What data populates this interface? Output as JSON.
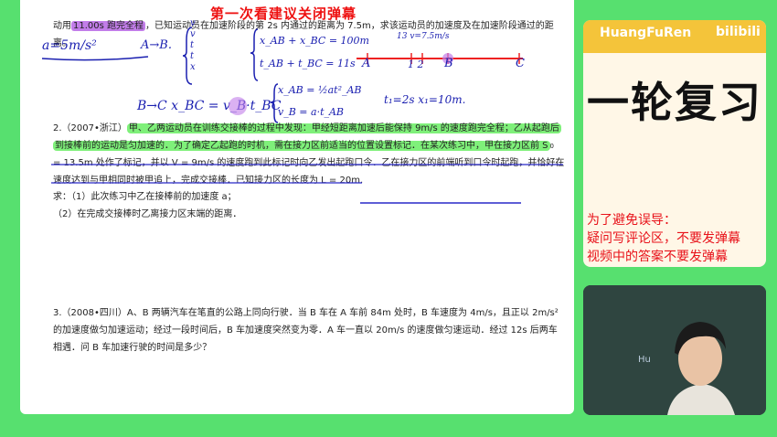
{
  "danmaku_warning": "第一次看建议关闭弹幕",
  "doc": {
    "top_line": "离。",
    "top_line_prefix": "动用",
    "top_line_highlight": "11.00s 跑完全程",
    "top_line_rest": "，已知运动员在加速阶段的第 2s 内通过的距离为 7.5m，求该运动员的加速度及在加速阶段通过的距",
    "q2_prefix": "2.（2007•浙江）",
    "q2_line1": "甲、乙两运动员在训练交接棒的过程中发现：甲经短距离加速后能保持 9m/s 的速度跑完全程；乙从起跑后",
    "q2_line2": "到接棒前的运动是匀加速的．为了确定乙起跑的时机，需在接力区前适当的位置设置标记．在某次练习中，甲在接力区前 S",
    "q2_line3": "= 13.5m 处作了标记，并以 V = 9m/s 的速度跑到此标记时向乙发出起跑口令．乙在接力区的前端听到口令时起跑，并恰好在",
    "q2_line4": "速度达到与甲相同时被甲追上，完成交接棒．已知接力区的长度为 L = 20m.",
    "q2_sub1": "求：（1）此次练习中乙在接棒前的加速度 a；",
    "q2_sub2": "（2）在完成交接棒时乙离接力区末端的距离．",
    "q3_line1": "3.（2008•四川）A、B 两辆汽车在笔直的公路上同向行驶．当 B 车在 A 车前 84m 处时，B 车速度为 4m/s，且正以 2m/s²",
    "q3_line2": "的加速度做匀加速运动；经过一段时间后，B 车加速度突然变为零．A 车一直以 20m/s 的速度做匀速运动．经过 12s 后两车",
    "q3_line3": "相遇．问 B 车加速行驶的时间是多少？",
    "handwriting": {
      "a_eq": "a=5m/s²",
      "a_to_b": "A→B.",
      "x_ab_sum": "x_AB + x_BC = 100m",
      "t_ab_sum": "t_AB + t_BC = 11s",
      "b_to_c": "B→C  x_BC = v_B·t_BC",
      "x_ab_eq": "x_AB = ½at²_AB",
      "v_b_eq": "v_B = a·t_AB",
      "t1_eq": "t₁=2s   x₁=10m.",
      "v_label": "13 v=7.5m/s",
      "pt_a": "A",
      "pt_12": "1  2",
      "pt_b": "B",
      "pt_c": "C",
      "list_v": "v",
      "list_t": "t",
      "list_x": "x"
    }
  },
  "sidebar": {
    "brand": "HuangFuRen",
    "site_logo": "bilibili",
    "big_title": "一轮复习",
    "notice_line1": "为了避免误导：",
    "notice_line2": "疑问写评论区，不要发弹幕",
    "notice_line3": "视频中的答案不要发弹幕"
  },
  "webcam": {
    "watermark": "Hu"
  }
}
